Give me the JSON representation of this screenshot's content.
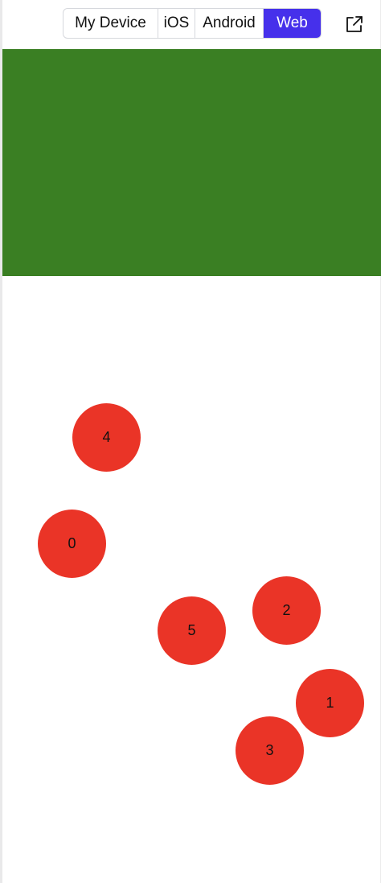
{
  "platform_tabs": {
    "items": [
      {
        "label": "My Device"
      },
      {
        "label": "iOS"
      },
      {
        "label": "Android"
      },
      {
        "label": "Web"
      }
    ],
    "selected": "Web",
    "accent_color": "#4630eb"
  },
  "toolbar": {
    "open_icon": "external-link-icon"
  },
  "preview": {
    "panel_color": "#3a7f23",
    "ball_color": "#ea3427",
    "balls": [
      {
        "label": "4"
      },
      {
        "label": "0"
      },
      {
        "label": "2"
      },
      {
        "label": "5"
      },
      {
        "label": "1"
      },
      {
        "label": "3"
      }
    ]
  }
}
